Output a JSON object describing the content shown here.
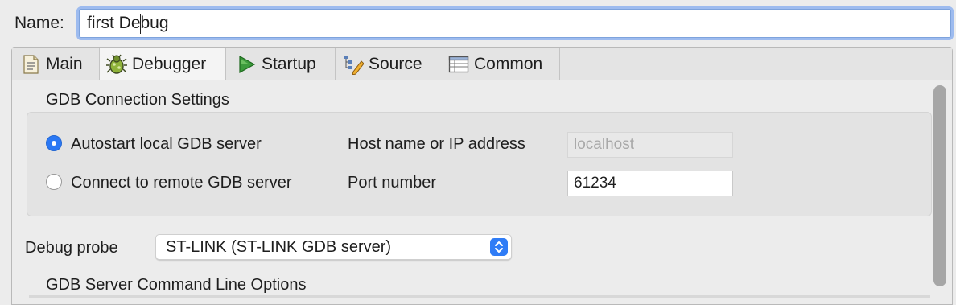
{
  "name_field": {
    "label": "Name:",
    "value": "first Debug"
  },
  "tabs": [
    {
      "label": "Main",
      "icon": "main-tab-icon",
      "active": false
    },
    {
      "label": "Debugger",
      "icon": "debugger-bug-icon",
      "active": true
    },
    {
      "label": "Startup",
      "icon": "startup-play-icon",
      "active": false
    },
    {
      "label": "Source",
      "icon": "source-lookup-icon",
      "active": false
    },
    {
      "label": "Common",
      "icon": "common-table-icon",
      "active": false
    }
  ],
  "gdb_connection": {
    "title": "GDB Connection Settings",
    "autostart_label": "Autostart local GDB server",
    "autostart_selected": true,
    "remote_label": "Connect to remote GDB server",
    "remote_selected": false,
    "host_label": "Host name or IP address",
    "host_value": "localhost",
    "port_label": "Port number",
    "port_value": "61234"
  },
  "debug_probe": {
    "label": "Debug probe",
    "selected": "ST-LINK (ST-LINK GDB server)"
  },
  "gdb_server_options": {
    "title": "GDB Server Command Line Options"
  },
  "colors": {
    "accent": "#2b78f4",
    "focus_ring": "#9dbbef",
    "background": "#ececec"
  }
}
